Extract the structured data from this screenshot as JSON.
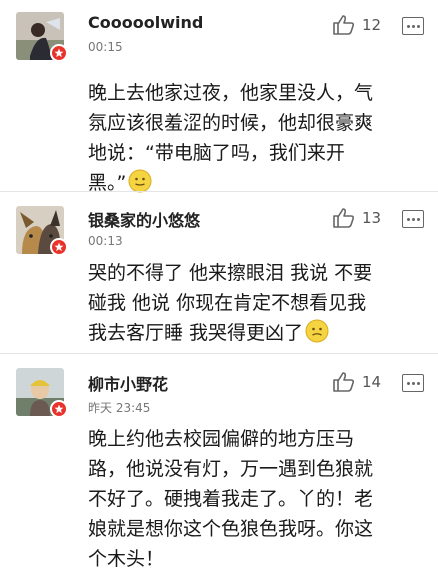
{
  "comments": [
    {
      "username": "Cooooolwind",
      "time": "00:15",
      "likes": "12",
      "text_lines": [
        "晚上去他家过夜，他家里没人，气",
        "氛应该很羞涩的时候，他却很豪爽",
        "地说：“带电脑了吗，我们来开",
        "黑。”"
      ],
      "emoji": "smiley-emoji"
    },
    {
      "username": "银桑家的小悠悠",
      "time": "00:13",
      "likes": "13",
      "text_lines": [
        "哭的不得了 他来擦眼泪 我说 不要",
        "碰我 他说 你现在肯定不想看见我",
        "我去客厅睡 我哭得更凶了"
      ],
      "emoji": "smiley-emoji"
    },
    {
      "username": "柳市小野花",
      "time": "昨天 23:45",
      "likes": "14",
      "text_lines": [
        "晚上约他去校园偏僻的地方压马",
        "路，他说没有灯，万一遇到色狼就",
        "不好了。硬拽着我走了。丫的！老",
        "娘就是想你这个色狼色我呀。你这",
        "个木头！"
      ],
      "emoji": ""
    }
  ],
  "icons": {
    "like": "thumbs-up-icon",
    "more": "more-icon",
    "badge": "verified-badge-icon"
  },
  "colors": {
    "badge": "#e8332c",
    "divider": "#e4e4e4",
    "meta_text": "#777777"
  }
}
